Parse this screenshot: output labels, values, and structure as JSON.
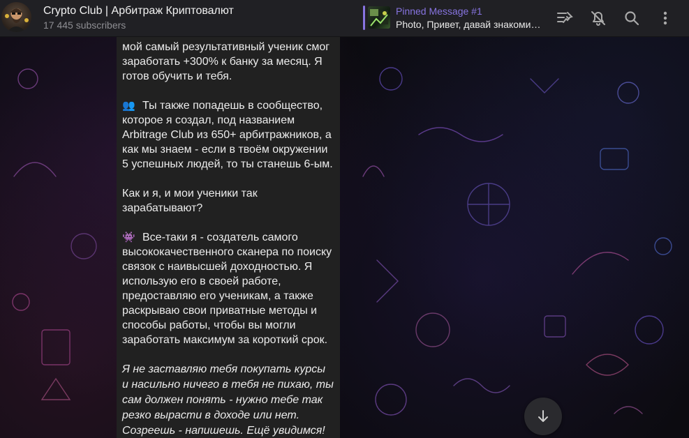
{
  "channel": {
    "title": "Crypto Club | Арбитраж Криптовалют",
    "subscribers": "17 445 subscribers",
    "avatar_icon": "bearded-man-avatar"
  },
  "pinned": {
    "title": "Pinned Message #1",
    "text": "Photo, Привет, давай знакомиться! Я",
    "accent": "#8774e1"
  },
  "header_icons": [
    "pinned-list-icon",
    "mute-bell-icon",
    "search-icon",
    "more-vertical-icon"
  ],
  "message": {
    "paragraphs": [
      "мой самый результативный ученик смог заработать +300% к банку за месяц. Я готов обучить и тебя.",
      "Ты также попадешь в сообщество, которое я создал, под названием Arbitrage Club из 650+ арбитражников, а как мы знаем - если в твоём окружении 5 успешных людей, то ты станешь 6-ым.",
      "Как и я, и мои ученики так зарабатывают?",
      "Все-таки я - создатель самого высококачественного сканера по поиску связок с наивысшей доходностью. Я использую его в своей работе, предоставляю его ученикам, а также раскрываю свои приватные методы и способы работы, чтобы вы могли заработать максимум за короткий срок.",
      "Я не заставляю тебя покупать курсы и насильно ничего в тебя не пихаю, ты сам должен понять - нужно тебе так резко вырасти в доходе или нет. Созреешь - напишешь. Ещё увидимся!"
    ],
    "emoji_1": "👥",
    "emoji_2": "👾"
  },
  "scroll_button_icon": "arrow-down-icon"
}
